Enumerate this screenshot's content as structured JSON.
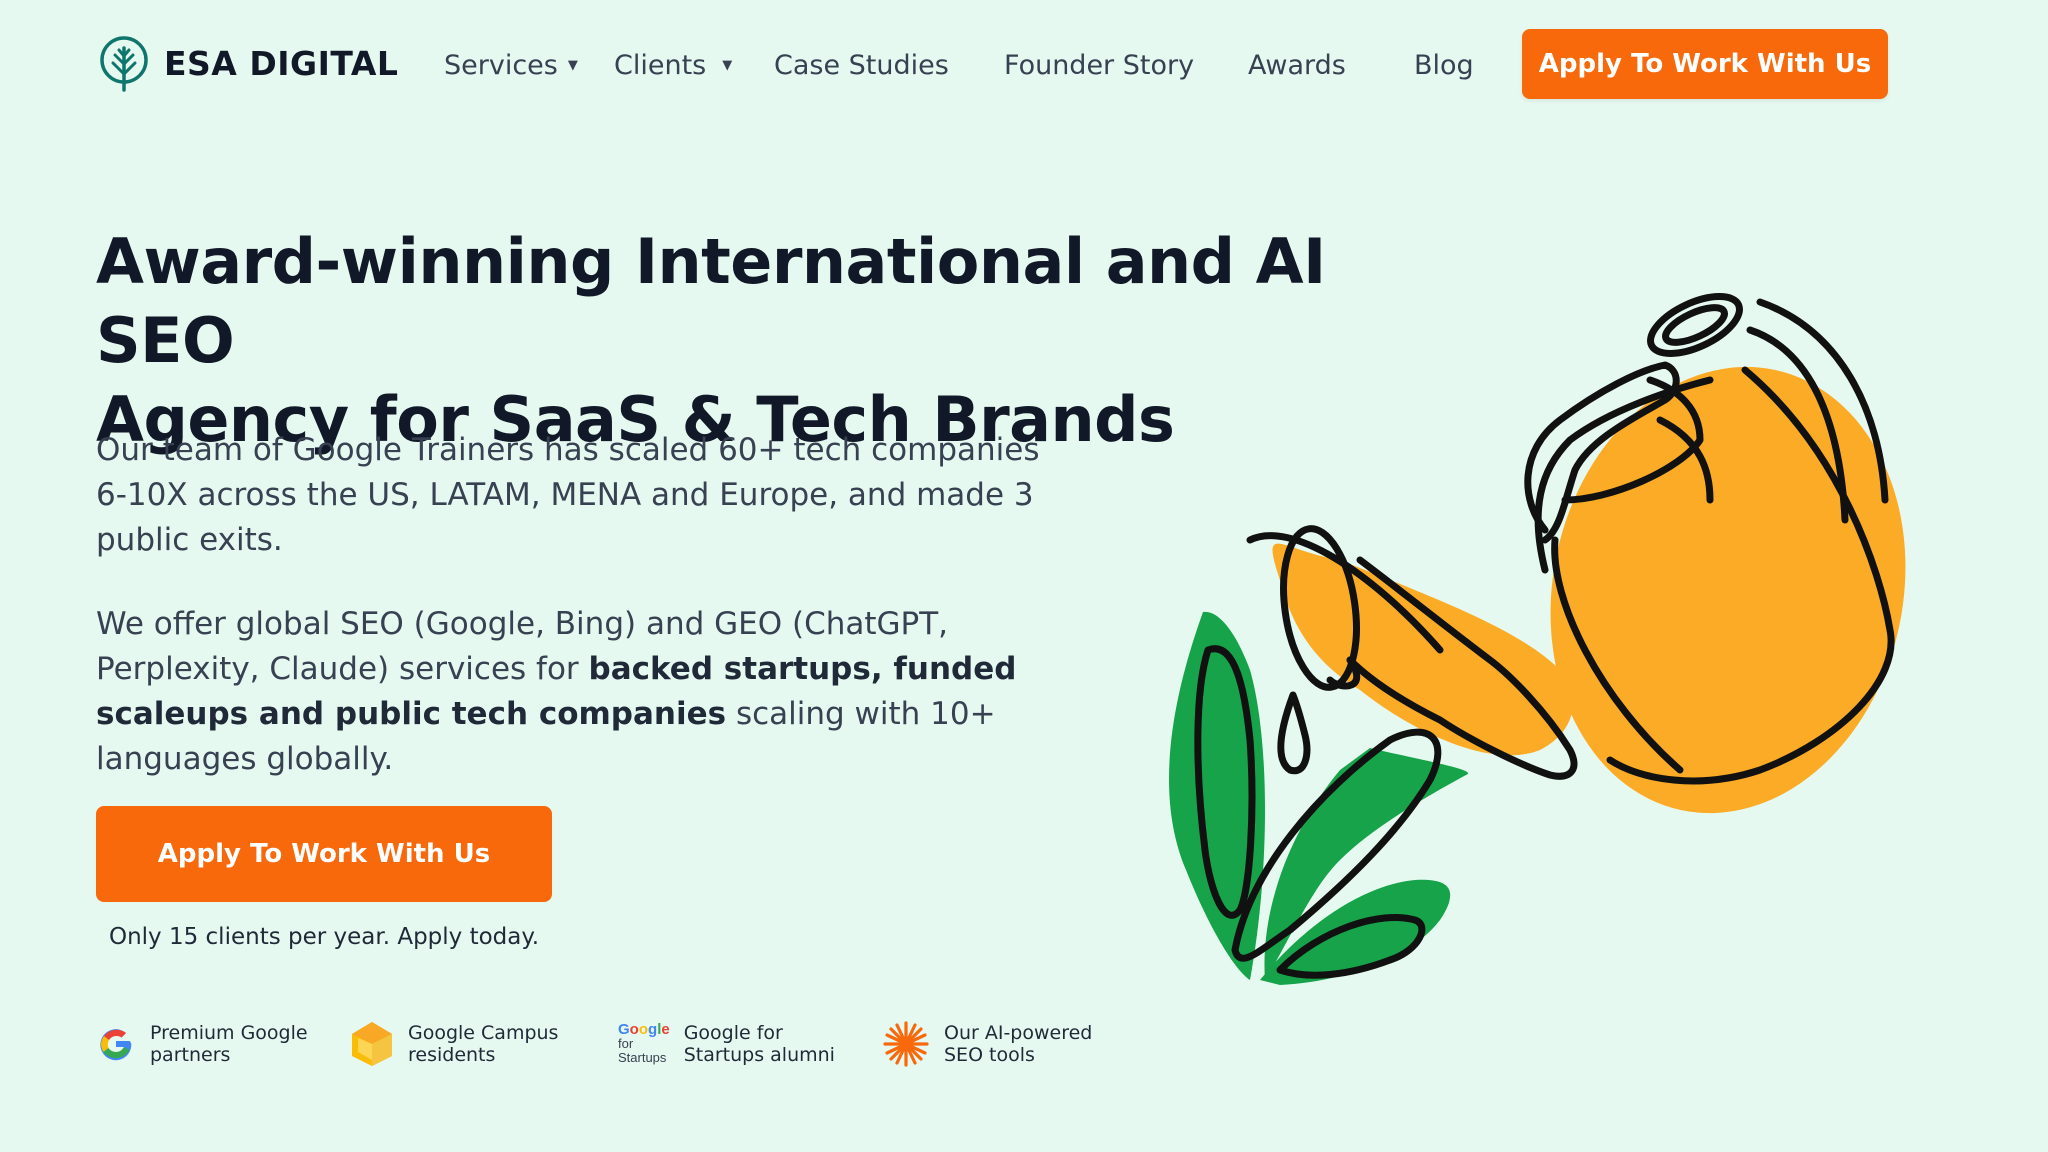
{
  "brand": {
    "name": "ESA DIGITAL",
    "color": "#0f766e"
  },
  "nav": {
    "items": [
      {
        "label": "Services",
        "dropdown": true
      },
      {
        "label": "Clients",
        "dropdown": true
      },
      {
        "label": "Case Studies",
        "dropdown": false
      },
      {
        "label": "Founder Story",
        "dropdown": false
      },
      {
        "label": "Awards",
        "dropdown": false
      },
      {
        "label": "Blog",
        "dropdown": false
      }
    ],
    "cta_label": "Apply To Work With Us"
  },
  "hero": {
    "headline_line1": "Award-winning International and AI SEO",
    "headline_line2": "Agency for SaaS & Tech Brands",
    "para1": "Our team of Google Trainers has scaled 60+ tech companies 6-10X across the US, LATAM, MENA and Europe, and made 3 public exits.",
    "para2_start": "We offer global SEO (Google, Bing) and GEO (ChatGPT, Perplexity, Claude) services for ",
    "para2_bold": "backed startups, funded scaleups and public tech companies",
    "para2_end": " scaling with 10+ languages globally.",
    "cta_label": "Apply To Work With Us",
    "cta_note": "Only 15 clients per year. Apply today."
  },
  "badges": [
    {
      "icon": "google-g-icon",
      "text": "Premium Google\npartners"
    },
    {
      "icon": "google-campus-icon",
      "text": "Google Campus\nresidents"
    },
    {
      "icon": "google-for-startups-logo",
      "logo_lines": [
        "Google",
        "for",
        "Startups"
      ],
      "text": "Google for\nStartups alumni"
    },
    {
      "icon": "ai-burst-icon",
      "text": "Our AI-powered\nSEO tools"
    }
  ],
  "colors": {
    "background": "#e6f9f0",
    "accent": "#f7690b",
    "illustration_orange": "#fbab26",
    "illustration_green": "#16a34a",
    "outline": "#111111"
  }
}
